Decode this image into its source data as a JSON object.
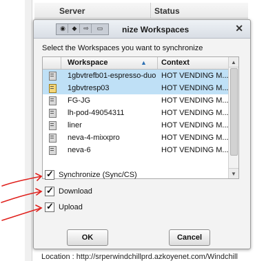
{
  "background": {
    "columns": [
      "Server",
      "Status"
    ],
    "footer": "Location : http://srperwindchillprd.azkoyenet.com/Windchill"
  },
  "dialog": {
    "title": "nize Workspaces",
    "instruction": "Select the Workspaces you want to synchronize",
    "table": {
      "headers": {
        "workspace": "Workspace",
        "context": "Context"
      },
      "sort_indicator": "▲",
      "rows": [
        {
          "workspace": "1gbvtrefb01-espresso-duo",
          "context": "HOT VENDING M...",
          "selected": true
        },
        {
          "workspace": "1gbvtresp03",
          "context": "HOT VENDING M...",
          "selected": true
        },
        {
          "workspace": "FG-JG",
          "context": "HOT VENDING M...",
          "selected": false
        },
        {
          "workspace": "lh-pod-49054311",
          "context": "HOT VENDING M...",
          "selected": false
        },
        {
          "workspace": "liner",
          "context": "HOT VENDING M...",
          "selected": false
        },
        {
          "workspace": "neva-4-mixxpro",
          "context": "HOT VENDING M...",
          "selected": false
        },
        {
          "workspace": "neva-6",
          "context": "HOT VENDING M...",
          "selected": false
        }
      ]
    },
    "options": [
      {
        "label": "Synchronize (Sync/CS)",
        "checked": true
      },
      {
        "label": "Download",
        "checked": true
      },
      {
        "label": "Upload",
        "checked": true
      }
    ],
    "buttons": {
      "ok": "OK",
      "cancel": "Cancel"
    }
  },
  "colors": {
    "selection": "#bfe0f6",
    "annotation": "#e0201c"
  }
}
